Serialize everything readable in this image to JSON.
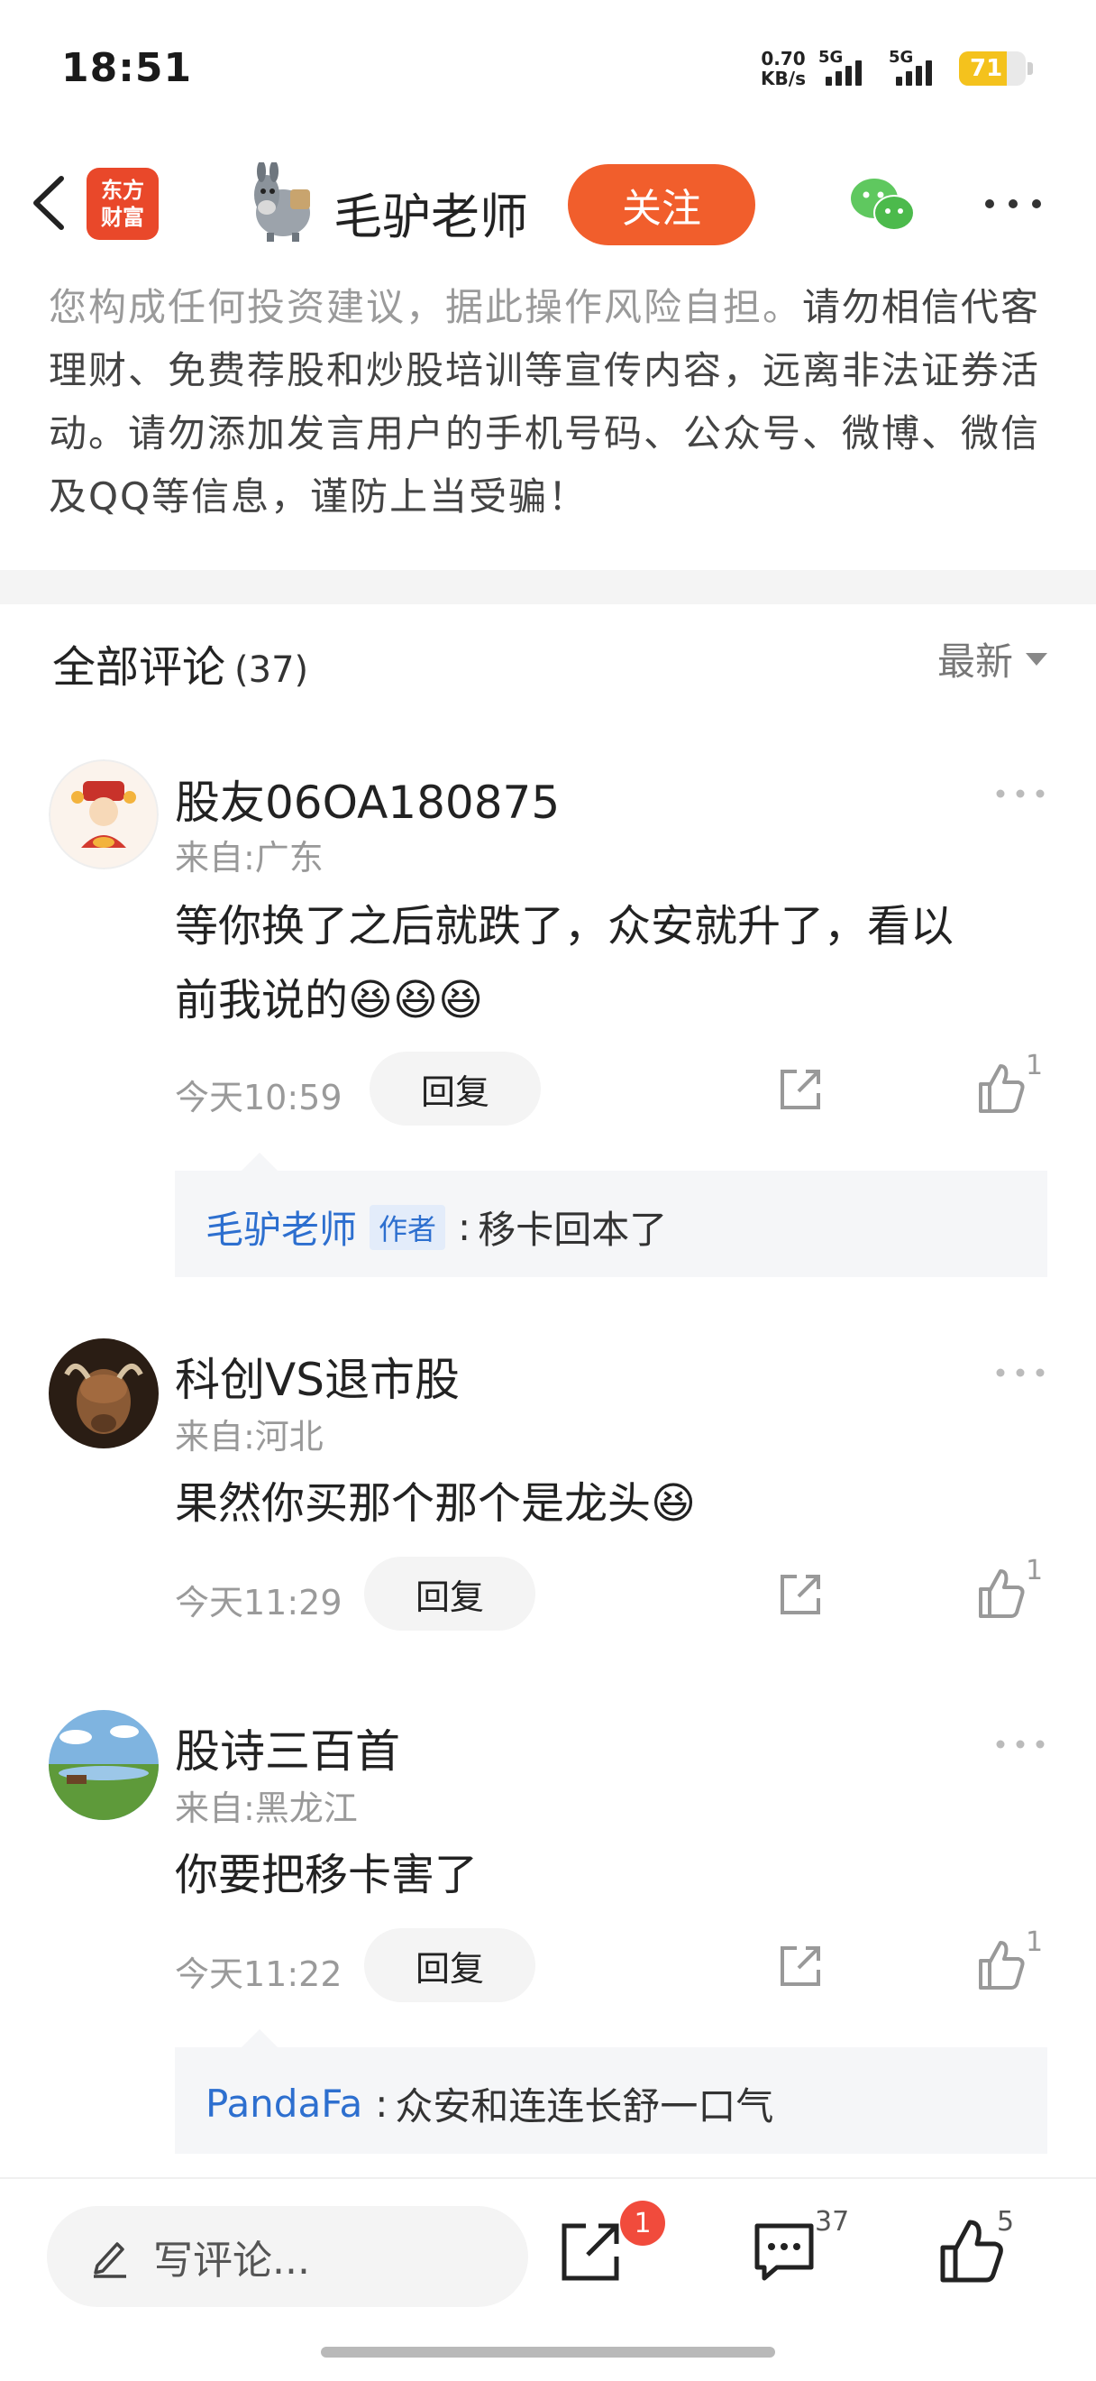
{
  "status_bar": {
    "time": "18:51",
    "net_speed_value": "0.70",
    "net_speed_unit": "KB/s",
    "sim1_label": "5G",
    "sim2_label": "5G",
    "battery_level": "71"
  },
  "header": {
    "logo_line1": "东方",
    "logo_line2": "财富",
    "author_name": "毛驴老师",
    "follow_label": "关注"
  },
  "disclaimer": {
    "muted_text": "您构成任何投资建议，据此操作风险自担。",
    "main_text": "请勿相信代客理财、免费荐股和炒股培训等宣传内容，远离非法证券活动。请勿添加发言用户的手机号码、公众号、微博、微信及QQ等信息，谨防上当受骗！"
  },
  "comments_header": {
    "title": "全部评论",
    "count": "(37)",
    "sort_label": "最新"
  },
  "comments": [
    {
      "user": "股友06OA180875",
      "location": "来自:广东",
      "text_line1": "等你换了之后就跌了，众安就升了，看以",
      "text_line2": "前我说的😆😆😆",
      "time": "今天10:59",
      "reply_label": "回复",
      "likes": "1",
      "reply": {
        "author": "毛驴老师",
        "badge": "作者",
        "text": "移卡回本了"
      }
    },
    {
      "user": "科创VS退市股",
      "location": "来自:河北",
      "text_line1": "果然你买那个那个是龙头😆",
      "time": "今天11:29",
      "reply_label": "回复",
      "likes": "1"
    },
    {
      "user": "股诗三百首",
      "location": "来自:黑龙江",
      "text_line1": "你要把移卡害了",
      "time": "今天11:22",
      "reply_label": "回复",
      "likes": "1",
      "reply": {
        "author": "PandaFa",
        "text": "众安和连连长舒一口气"
      }
    }
  ],
  "bottom_bar": {
    "write_placeholder": "写评论...",
    "share_badge": "1",
    "comment_count": "37",
    "like_count": "5"
  },
  "colors": {
    "follow_button": "#f15e2c",
    "logo_bg": "#e9482a",
    "reply_author": "#2d6fcf",
    "battery_fill": "#f4c21d",
    "badge_red": "#f14b3c"
  },
  "icons": [
    "back-icon",
    "donkey-avatar",
    "wechat-icon",
    "more-icon",
    "share-icon",
    "like-icon",
    "pencil-icon",
    "comment-icon",
    "chevron-down-icon"
  ]
}
